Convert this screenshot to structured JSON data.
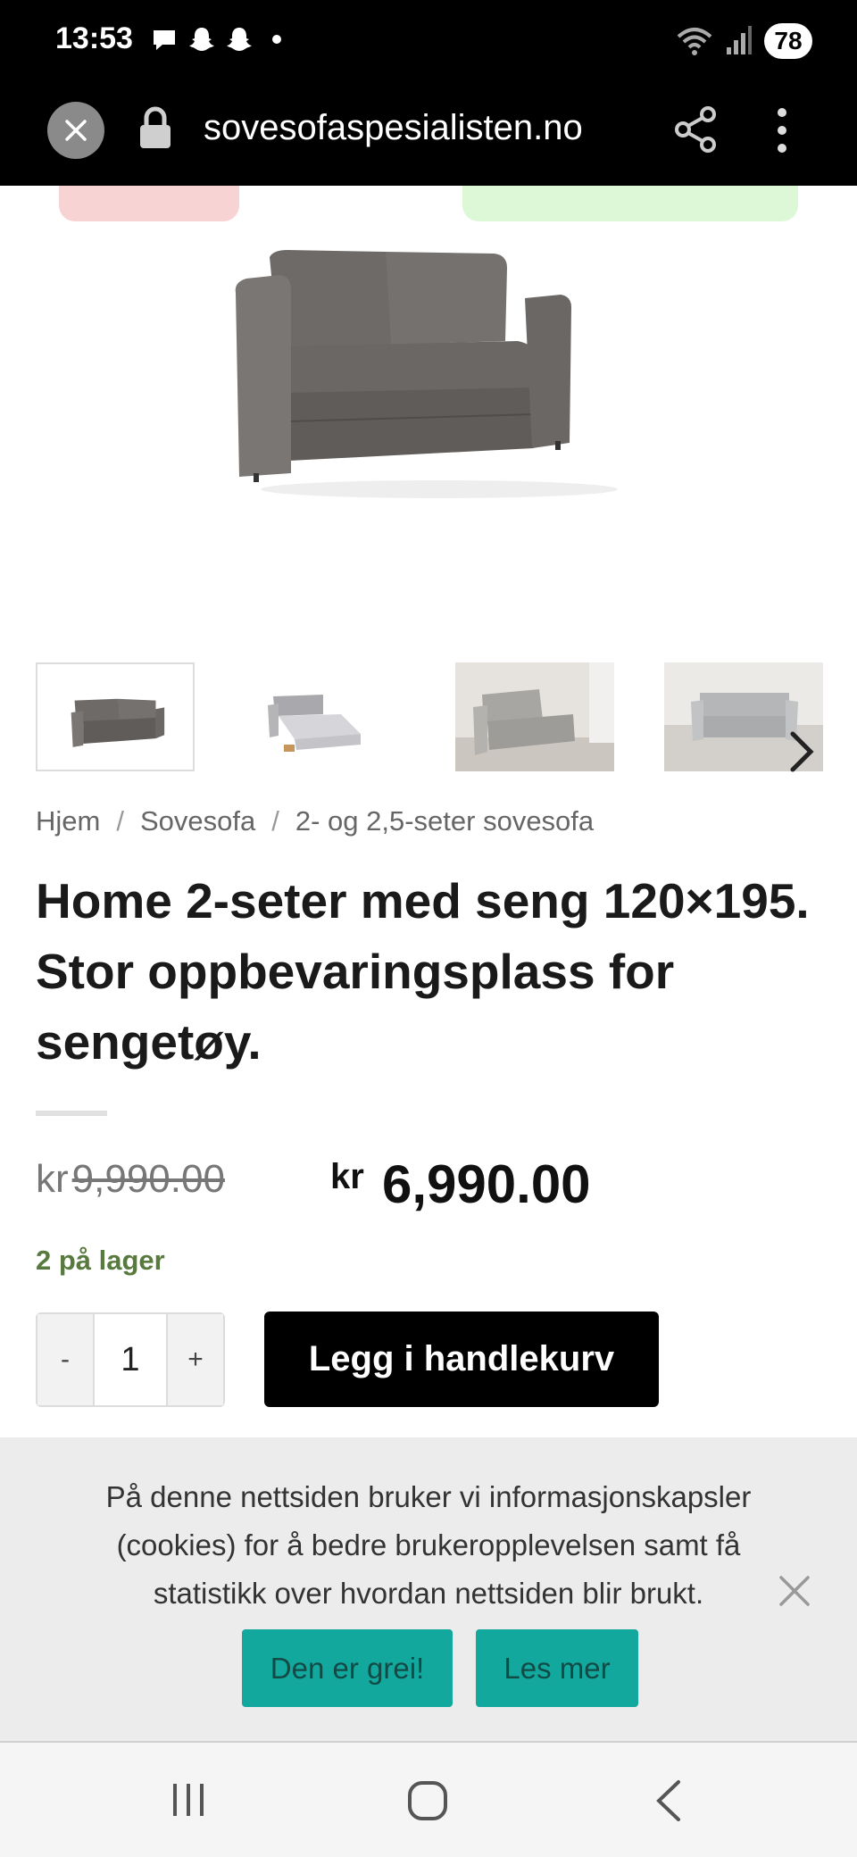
{
  "status_bar": {
    "time": "13:53",
    "battery": "78",
    "notification_icons": [
      "chat-bubble-icon",
      "snapchat-icon",
      "snapchat-icon",
      "dot-icon"
    ],
    "system_icons": [
      "wifi-icon",
      "signal-icon",
      "battery-icon"
    ]
  },
  "browser": {
    "url": "sovesofaspesialisten.no",
    "icons": [
      "close-icon",
      "lock-icon",
      "share-icon",
      "more-vert-icon"
    ]
  },
  "breadcrumb": [
    "Hjem",
    "Sovesofa",
    "2- og 2,5-seter sovesofa"
  ],
  "breadcrumb_separator": "/",
  "product": {
    "title": "Home 2-seter med seng 120×195. Stor oppbevaringsplass for sengetøy.",
    "price_old_currency": "kr",
    "price_old": "9,990.00",
    "price_currency": "kr",
    "price": "6,990.00",
    "stock": "2 på lager",
    "quantity": "1",
    "qty_minus": "-",
    "qty_plus": "+",
    "add_to_cart": "Legg i handlekurv"
  },
  "cookie_banner": {
    "text": "På denne nettsiden bruker vi informasjonskapsler (cookies) for å bedre brukeropplevelsen samt få statistikk over hvordan nettsiden blir brukt.",
    "accept": "Den er grei!",
    "more": "Les mer"
  },
  "colors": {
    "accent_teal": "#13a89e",
    "stock_green": "#587a3f",
    "badge_red": "#f8d3d3",
    "badge_green": "#dcf8d6"
  }
}
